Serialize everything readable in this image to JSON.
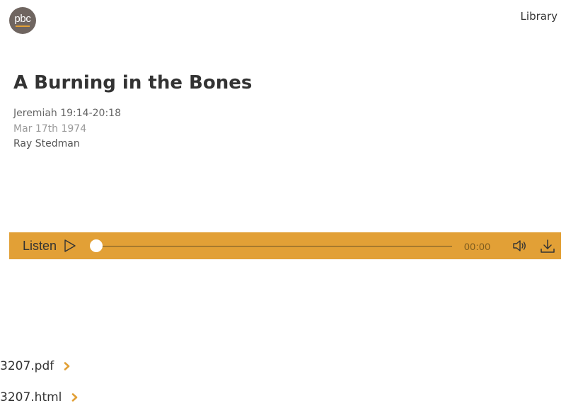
{
  "header": {
    "logo_text": "pbc",
    "logo_color": "#6f6560",
    "library_link": "Library"
  },
  "sermon": {
    "title": "A Burning in the Bones",
    "passage": "Jeremiah 19:14-20:18",
    "date": "Mar 17th 1974",
    "speaker": "Ray Stedman"
  },
  "player": {
    "listen_label": "Listen",
    "play_icon": "play-icon",
    "progress": 0,
    "time": "00:00",
    "volume_icon": "volume-icon",
    "download_icon": "download-icon",
    "accent_color": "#e2a036"
  },
  "files": [
    {
      "label": "3207.pdf"
    },
    {
      "label": "3207.html"
    }
  ]
}
